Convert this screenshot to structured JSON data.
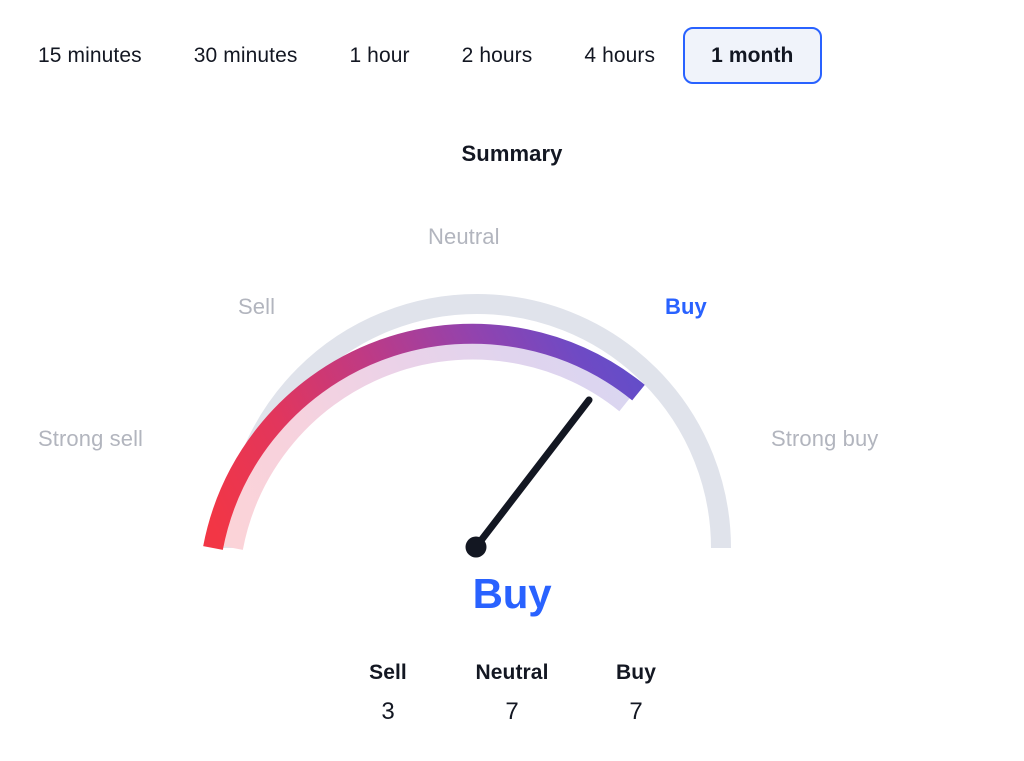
{
  "timeframes": {
    "tabs": [
      {
        "label": "15 minutes",
        "active": false
      },
      {
        "label": "30 minutes",
        "active": false
      },
      {
        "label": "1 hour",
        "active": false
      },
      {
        "label": "2 hours",
        "active": false
      },
      {
        "label": "4 hours",
        "active": false
      },
      {
        "label": "1 month",
        "active": true
      }
    ],
    "selected": "1 month"
  },
  "summary": {
    "title": "Summary",
    "verdict": "Buy",
    "verdict_color": "#2962FF"
  },
  "gauge": {
    "zones": [
      {
        "key": "strong_sell",
        "label": "Strong sell",
        "highlight": false
      },
      {
        "key": "sell",
        "label": "Sell",
        "highlight": false
      },
      {
        "key": "neutral",
        "label": "Neutral",
        "highlight": false
      },
      {
        "key": "buy",
        "label": "Buy",
        "highlight": true
      },
      {
        "key": "strong_buy",
        "label": "Strong buy",
        "highlight": false
      }
    ],
    "needle_zone": "Buy",
    "track_color": "#E0E3EB",
    "colors": {
      "red": "#F23645",
      "crimson": "#DE3163",
      "magenta": "#B13A8E",
      "purple": "#8B46B5",
      "violet": "#5E4FCB",
      "pale_red": "#FBD5DA",
      "pale_magenta": "#EBD2E8",
      "pale_violet": "#DAD6F0"
    }
  },
  "counts": {
    "columns": [
      {
        "label": "Sell",
        "value": "3"
      },
      {
        "label": "Neutral",
        "value": "7"
      },
      {
        "label": "Buy",
        "value": "7"
      }
    ]
  },
  "chart_data": {
    "type": "gauge",
    "title": "Summary",
    "categories": [
      "Strong sell",
      "Sell",
      "Neutral",
      "Buy",
      "Strong buy"
    ],
    "values": [
      3,
      7,
      7
    ],
    "series": [
      {
        "name": "Sell",
        "values": [
          3
        ]
      },
      {
        "name": "Neutral",
        "values": [
          7
        ]
      },
      {
        "name": "Buy",
        "values": [
          7
        ]
      }
    ],
    "value_labels": [
      "Sell",
      "Neutral",
      "Buy"
    ],
    "reading": "Buy",
    "needle_fraction": 0.708,
    "needle_angle_deg": 127.5,
    "angle_range_deg": [
      180,
      0
    ],
    "ylim": [
      0,
      5
    ],
    "xlabel": "",
    "ylabel": "",
    "grid": false,
    "legend": "none",
    "timeframe": "1 month",
    "annotations": [
      "Strong sell",
      "Sell",
      "Neutral",
      "Buy",
      "Strong buy"
    ]
  }
}
